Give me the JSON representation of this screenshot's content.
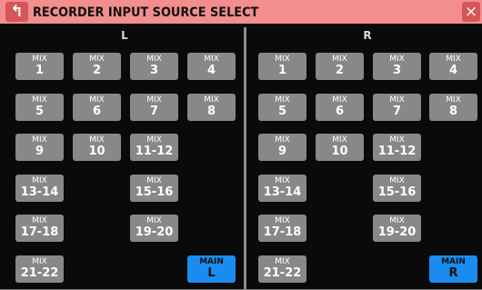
{
  "header": {
    "title": "RECORDER INPUT SOURCE SELECT",
    "back_icon": "back-arrow-icon",
    "close_label": "×",
    "accent_color": "#f28e8e"
  },
  "left": {
    "label": "L",
    "buttons": [
      [
        "MIX",
        "1"
      ],
      [
        "MIX",
        "2"
      ],
      [
        "MIX",
        "3"
      ],
      [
        "MIX",
        "4"
      ],
      [
        "MIX",
        "5"
      ],
      [
        "MIX",
        "6"
      ],
      [
        "MIX",
        "7"
      ],
      [
        "MIX",
        "8"
      ],
      [
        "MIX",
        "9"
      ],
      [
        "MIX",
        "10"
      ],
      [
        "MIX",
        "11-12"
      ],
      [
        "MIX",
        "13-14"
      ],
      [
        "MIX",
        "15-16"
      ],
      [
        "MIX",
        "17-18"
      ],
      [
        "MIX",
        "19-20"
      ],
      [
        "MIX",
        "21-22"
      ],
      [
        "MAIN",
        "L"
      ]
    ]
  },
  "right": {
    "label": "R",
    "buttons": [
      [
        "MIX",
        "1"
      ],
      [
        "MIX",
        "2"
      ],
      [
        "MIX",
        "3"
      ],
      [
        "MIX",
        "4"
      ],
      [
        "MIX",
        "5"
      ],
      [
        "MIX",
        "6"
      ],
      [
        "MIX",
        "7"
      ],
      [
        "MIX",
        "8"
      ],
      [
        "MIX",
        "9"
      ],
      [
        "MIX",
        "10"
      ],
      [
        "MIX",
        "11-12"
      ],
      [
        "MIX",
        "13-14"
      ],
      [
        "MIX",
        "15-16"
      ],
      [
        "MIX",
        "17-18"
      ],
      [
        "MIX",
        "19-20"
      ],
      [
        "MIX",
        "21-22"
      ],
      [
        "MAIN",
        "R"
      ]
    ]
  },
  "selected_color": "#1a8cf0"
}
